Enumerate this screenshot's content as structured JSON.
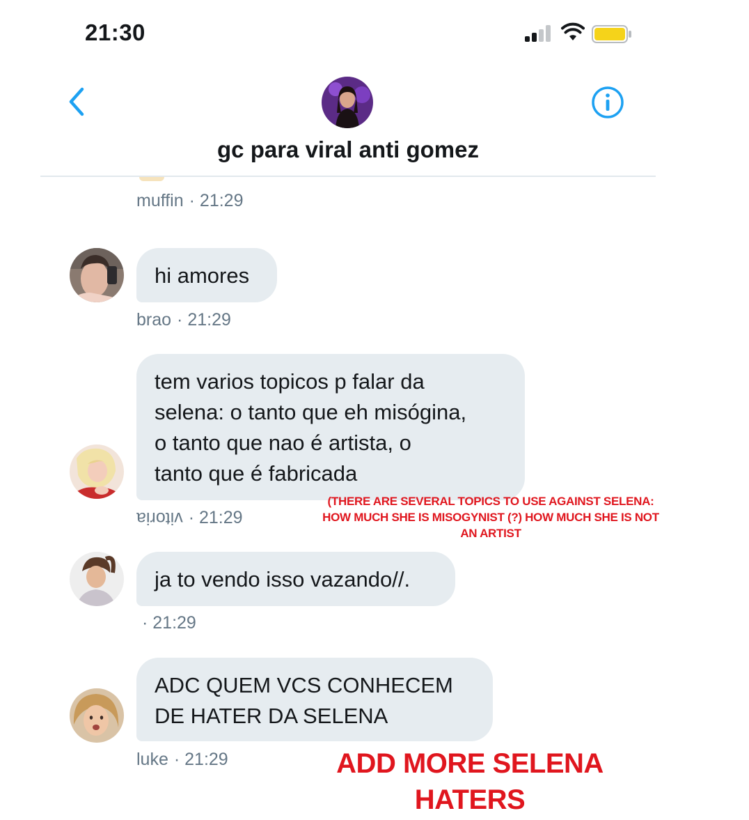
{
  "status_bar": {
    "time": "21:30",
    "signal_bars": 2,
    "battery_color": "#f5d31a"
  },
  "header": {
    "title": "gc para viral anti gomez",
    "back_icon": "chevron-left-icon",
    "info_icon": "info-icon",
    "accent": "#1da1f2"
  },
  "messages": [
    {
      "author": "muffin",
      "time": "· 21:29"
    },
    {
      "author": "brao",
      "time": "· 21:29",
      "lines": [
        "hi amores"
      ]
    },
    {
      "author": "vitoria",
      "time": "· 21:29",
      "lines": [
        "tem varios topicos p falar da",
        "selena: o tanto que eh misógina,",
        "o tanto que nao é artista, o",
        "tanto que é fabricada"
      ]
    },
    {
      "author": "",
      "time": "· 21:29",
      "lines": [
        "ja to vendo isso vazando//."
      ]
    },
    {
      "author": "luke",
      "time": "· 21:29",
      "lines": [
        "ADC QUEM VCS CONHECEM",
        "DE HATER DA SELENA"
      ]
    }
  ],
  "annotations": {
    "translation": [
      "(THERE ARE SEVERAL TOPICS TO USE AGAINST SELENA:",
      "HOW MUCH SHE IS MISOGYNIST (?) HOW MUCH SHE IS NOT",
      "AN ARTIST"
    ],
    "caption": "ADD MORE SELENA HATERS",
    "color": "#e0161e"
  }
}
